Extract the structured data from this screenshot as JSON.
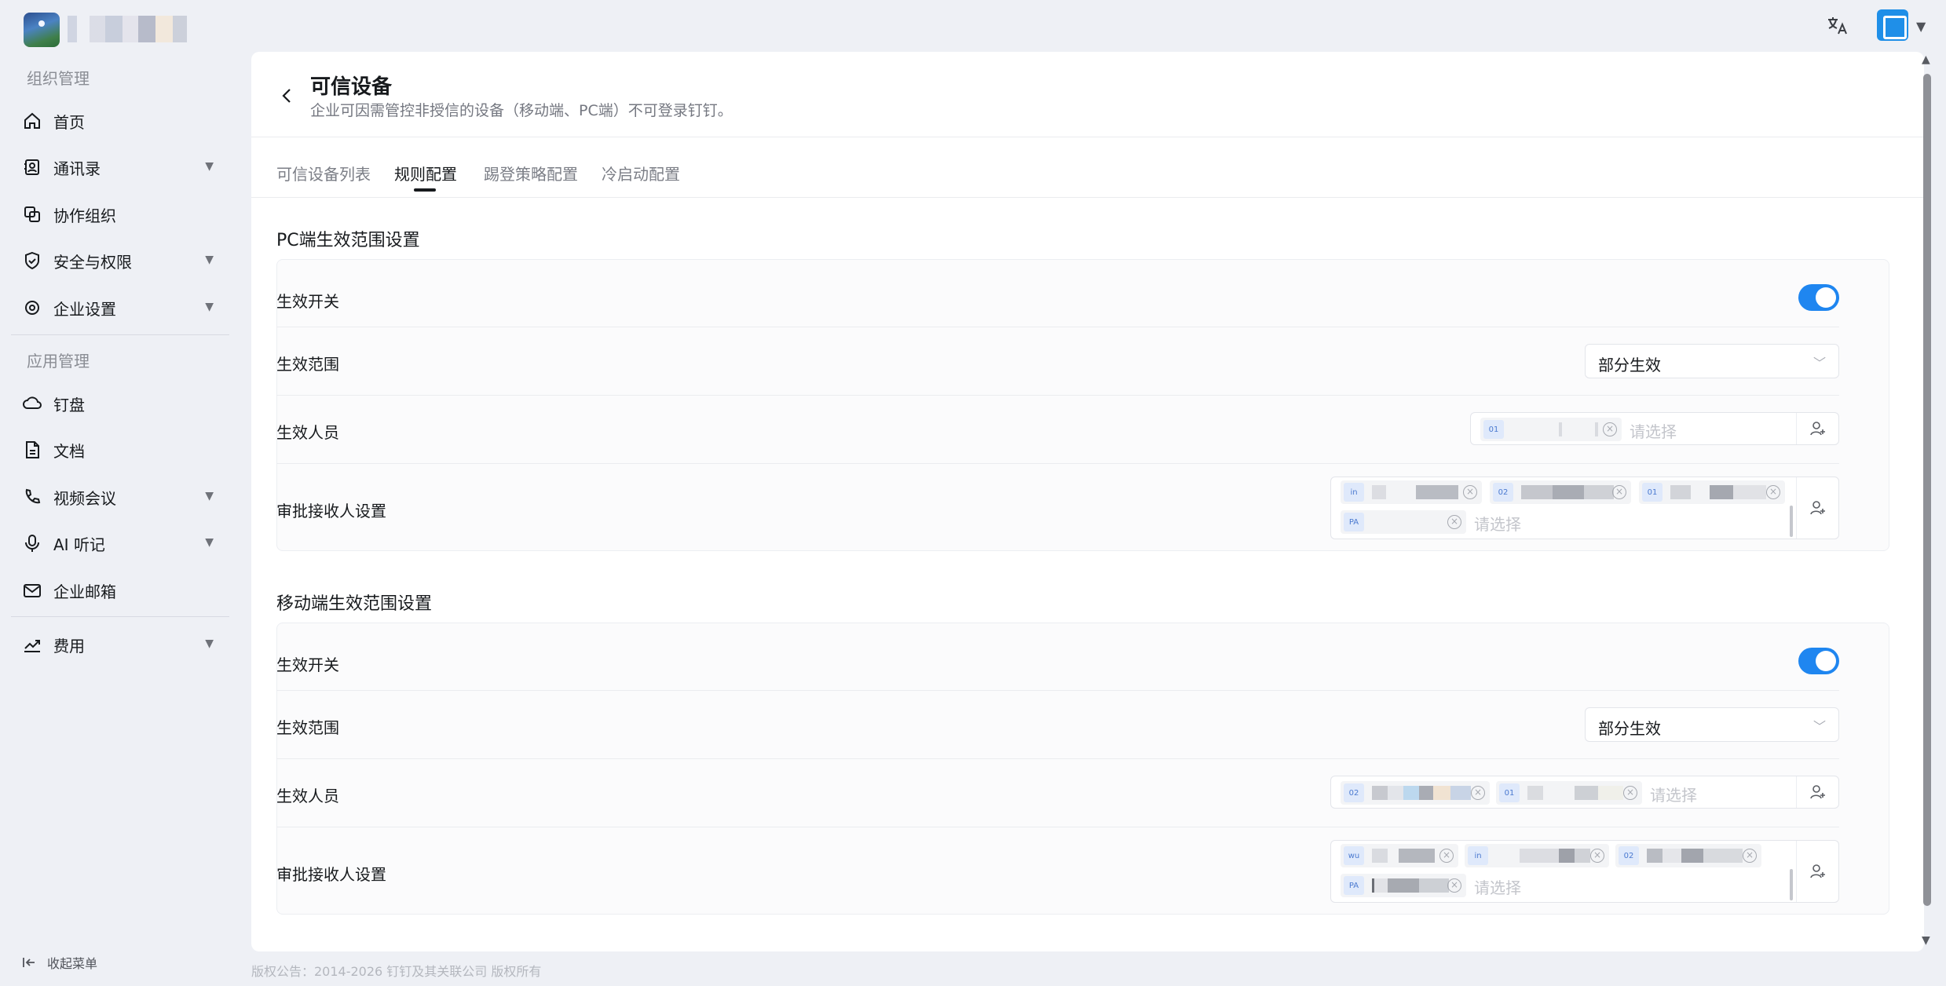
{
  "header": {
    "org_logo": "org-logo-blurred",
    "org_name": "",
    "translate_icon": "translate-icon",
    "avatar_icon": "user-avatar"
  },
  "sidebar": {
    "group1_title": "组织管理",
    "group2_title": "应用管理",
    "items": [
      {
        "label": "首页",
        "icon": "home-icon",
        "has_arrow": false
      },
      {
        "label": "通讯录",
        "icon": "contacts-icon",
        "has_arrow": true
      },
      {
        "label": "协作组织",
        "icon": "collaboration-icon",
        "has_arrow": false
      },
      {
        "label": "安全与权限",
        "icon": "shield-icon",
        "has_arrow": true
      },
      {
        "label": "企业设置",
        "icon": "settings-icon",
        "has_arrow": true
      },
      {
        "label": "钉盘",
        "icon": "cloud-drive-icon",
        "has_arrow": false
      },
      {
        "label": "文档",
        "icon": "document-icon",
        "has_arrow": false
      },
      {
        "label": "视频会议",
        "icon": "video-call-icon",
        "has_arrow": true
      },
      {
        "label": "AI 听记",
        "icon": "ai-recorder-icon",
        "has_arrow": true
      },
      {
        "label": "企业邮箱",
        "icon": "mail-icon",
        "has_arrow": false
      },
      {
        "label": "费用",
        "icon": "chart-icon",
        "has_arrow": true
      }
    ],
    "collapse_label": "收起菜单"
  },
  "footer": {
    "copyright": "版权公告：2014-2026 钉钉及其关联公司 版权所有"
  },
  "page": {
    "title": "可信设备",
    "subtitle": "企业可因需管控非授信的设备（移动端、PC端）不可登录钉钉。",
    "tabs": [
      {
        "label": "可信设备列表",
        "active": false
      },
      {
        "label": "规则配置",
        "active": true
      },
      {
        "label": "踢登策略配置",
        "active": false
      },
      {
        "label": "冷启动配置",
        "active": false
      }
    ]
  },
  "pc_section": {
    "title": "PC端生效范围设置",
    "switch_label": "生效开关",
    "switch_on": true,
    "scope_label": "生效范围",
    "scope_value": "部分生效",
    "members_label": "生效人员",
    "members_placeholder": "请选择",
    "members_tags": [
      "01"
    ],
    "approvers_label": "审批接收人设置",
    "approvers_placeholder": "请选择",
    "approvers_tags": [
      "in",
      "02",
      "01",
      "PA"
    ]
  },
  "mobile_section": {
    "title": "移动端生效范围设置",
    "switch_label": "生效开关",
    "switch_on": true,
    "scope_label": "生效范围",
    "scope_value": "部分生效",
    "members_label": "生效人员",
    "members_placeholder": "请选择",
    "members_tags": [
      "02",
      "01"
    ],
    "approvers_label": "审批接收人设置",
    "approvers_placeholder": "请选择",
    "approvers_tags": [
      "wu",
      "in",
      "02",
      "PA"
    ]
  },
  "colors": {
    "accent": "#1f86f0",
    "background": "#eef0f5",
    "panel": "#ffffff"
  }
}
